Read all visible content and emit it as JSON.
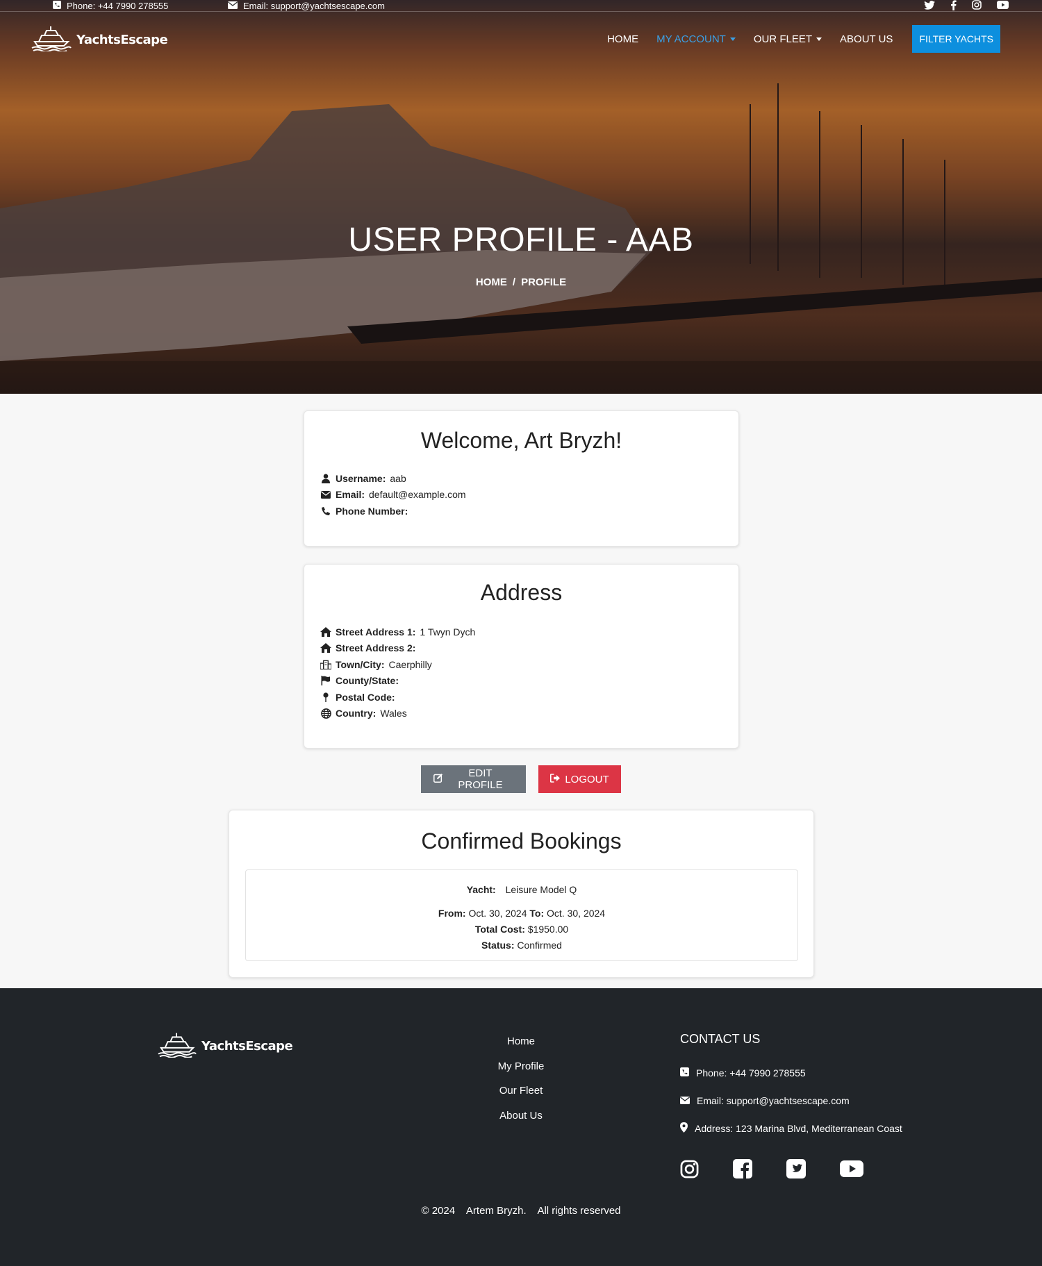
{
  "topbar": {
    "phone": "Phone: +44 7990 278555",
    "email": "Email: support@yachtsescape.com",
    "social_icons": [
      "twitter-icon",
      "facebook-icon",
      "instagram-icon",
      "youtube-icon"
    ]
  },
  "brand": {
    "name": "YachtsEscape"
  },
  "nav": {
    "home": "HOME",
    "my_account": "MY ACCOUNT",
    "our_fleet": "OUR FLEET",
    "about_us": "ABOUT US",
    "filter_yachts": "FILTER YACHTS"
  },
  "hero": {
    "title": "USER PROFILE - AAB",
    "breadcrumb": {
      "home": "HOME",
      "separator": "/",
      "current": "PROFILE"
    }
  },
  "profile": {
    "welcome": "Welcome, Art Bryzh!",
    "username_label": "Username:",
    "username": "aab",
    "email_label": "Email:",
    "email": "default@example.com",
    "phone_label": "Phone Number:",
    "phone": ""
  },
  "address": {
    "title": "Address",
    "street1_label": "Street Address 1:",
    "street1": "1 Twyn Dych",
    "street2_label": "Street Address 2:",
    "street2": "",
    "town_label": "Town/City:",
    "town": "Caerphilly",
    "county_label": "County/State:",
    "county": "",
    "postal_label": "Postal Code:",
    "postal": "",
    "country_label": "Country:",
    "country": "Wales"
  },
  "actions": {
    "edit": "EDIT PROFILE",
    "logout": "LOGOUT"
  },
  "bookings": {
    "title": "Confirmed Bookings",
    "items": [
      {
        "yacht_label": "Yacht:",
        "yacht": "Leisure Model Q",
        "from_label": "From:",
        "from": "Oct. 30, 2024",
        "to_label": "To:",
        "to": "Oct. 30, 2024",
        "cost_label": "Total Cost:",
        "cost": "$1950.00",
        "status_label": "Status:",
        "status": "Confirmed"
      }
    ]
  },
  "footer": {
    "links": [
      "Home",
      "My Profile",
      "Our Fleet",
      "About Us"
    ],
    "contact_title": "CONTACT US",
    "phone": "Phone: +44 7990 278555",
    "email": "Email: support@yachtsescape.com",
    "address": "Address: 123 Marina Blvd, Mediterranean Coast",
    "social_icons": [
      "instagram-icon",
      "facebook-icon",
      "twitter-icon",
      "youtube-icon"
    ],
    "copyright": "© 2024    Artem Bryzh.    All rights reserved"
  },
  "colors": {
    "accent": "#0d8fde",
    "active_nav": "#3aa0e6",
    "edit_button": "#6b737b",
    "logout_button": "#dc3545",
    "footer_bg": "#212529"
  }
}
